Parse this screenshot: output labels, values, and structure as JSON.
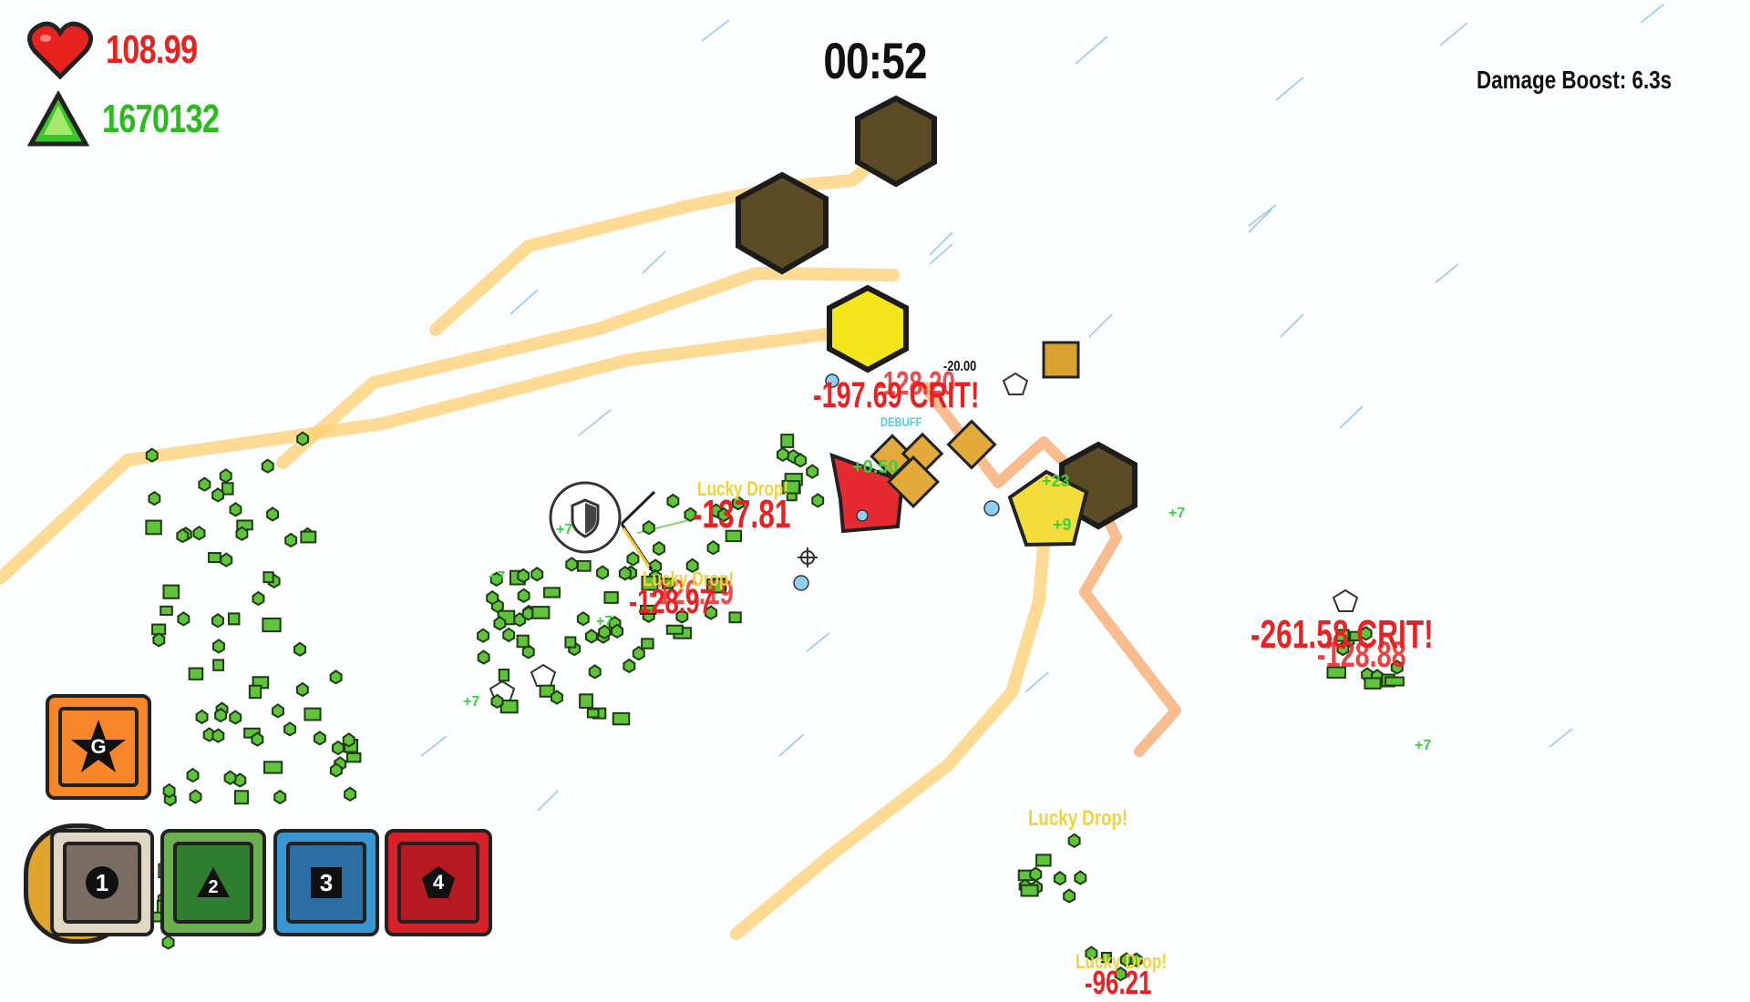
{
  "hud": {
    "health": "108.99",
    "xp": "1670132",
    "timer": "00:52",
    "damage_boost": "Damage Boost: 6.3s",
    "health_color": "#e8231f",
    "xp_color": "#2bbb1f"
  },
  "ability_slots": [
    {
      "key": "G",
      "color": "#f7862a",
      "icon": "star-icon"
    },
    {
      "key": "1",
      "color": "#e0d6c4",
      "icon": "circle-icon"
    },
    {
      "key": "2",
      "color": "#4e9a38",
      "icon": "triangle-icon"
    },
    {
      "key": "3",
      "color": "#3a95d3",
      "icon": "square-icon"
    },
    {
      "key": "4",
      "color": "#d82028",
      "icon": "pentagon-icon"
    }
  ],
  "floating_texts": {
    "crit_center_1": "-197.69 CRIT!",
    "crit_center_2": "-128.20",
    "small_hit": "-20.00",
    "dmg_left_1": "-137.81",
    "dmg_left_2": "-128.97",
    "dmg_left_3": "-126.19",
    "lucky_1": "Lucky Drop!",
    "lucky_2": "Lucky Drop!",
    "lucky_3": "Lucky Drop!",
    "lucky_4": "Lucky Drop!",
    "crit_right_1": "-261.58 CRIT!",
    "crit_right_2": "-128.88",
    "dmg_bottom": "-96.21",
    "xp_gain_1": "+7",
    "xp_gain_2": "+7",
    "xp_gain_3": "+7",
    "xp_gain_4": "+7",
    "xp_gain_5": "+7",
    "xp_gain_6": "+7",
    "xp_gain_7": "+9",
    "xp_gain_8": "+23",
    "xp_gain_9": "+0.50",
    "debuff": "DEBUFF"
  }
}
